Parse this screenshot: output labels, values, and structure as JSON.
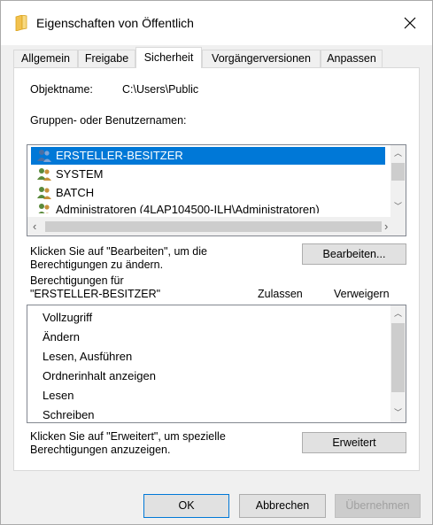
{
  "window": {
    "title": "Eigenschaften von Öffentlich"
  },
  "tabs": [
    {
      "label": "Allgemein"
    },
    {
      "label": "Freigabe"
    },
    {
      "label": "Sicherheit"
    },
    {
      "label": "Vorgängerversionen"
    },
    {
      "label": "Anpassen"
    }
  ],
  "object": {
    "label": "Objektname:",
    "value": "C:\\Users\\Public"
  },
  "groups": {
    "label": "Gruppen- oder Benutzernamen:",
    "items": [
      {
        "name": "ERSTELLER-BESITZER",
        "selected": true
      },
      {
        "name": "SYSTEM",
        "selected": false
      },
      {
        "name": "BATCH",
        "selected": false
      },
      {
        "name": "Administratoren (4LAP104500-ILH\\Administratoren)",
        "selected": false
      }
    ]
  },
  "edit": {
    "hint": "Klicken Sie auf \"Bearbeiten\", um die Berechtigungen zu ändern.",
    "button": "Bearbeiten..."
  },
  "permissions": {
    "label_line1": "Berechtigungen für",
    "label_line2": "\"ERSTELLER-BESITZER\"",
    "col_allow": "Zulassen",
    "col_deny": "Verweigern",
    "items": [
      "Vollzugriff",
      "Ändern",
      "Lesen, Ausführen",
      "Ordnerinhalt anzeigen",
      "Lesen",
      "Schreiben"
    ]
  },
  "advanced": {
    "hint": "Klicken Sie auf \"Erweitert\", um spezielle Berechtigungen anzuzeigen.",
    "button": "Erweitert"
  },
  "footer": {
    "ok": "OK",
    "cancel": "Abbrechen",
    "apply": "Übernehmen"
  },
  "colors": {
    "selection": "#0078d7",
    "folder_icon": "#f2c14e"
  }
}
